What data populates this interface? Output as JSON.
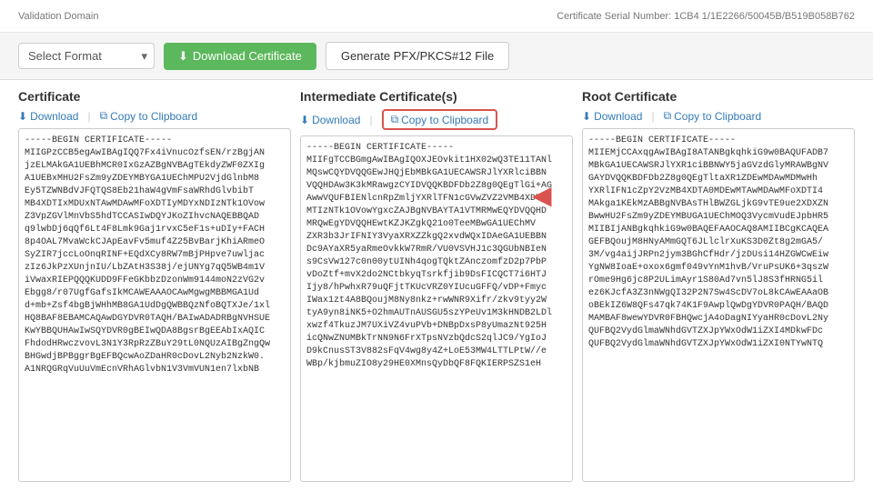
{
  "meta": {
    "left_label": "Validation Domain",
    "right_label": "Certificate Serial Number: 1CB4 1/1E2266/50045B/B519B058B762"
  },
  "toolbar": {
    "select_placeholder": "Select Format",
    "download_btn": "Download Certificate",
    "pfx_btn": "Generate PFX/PKCS#12 File",
    "download_icon": "⬇"
  },
  "columns": [
    {
      "id": "certificate",
      "title": "Certificate",
      "download_label": "Download",
      "copy_label": "Copy to Clipboard",
      "cert_text": "-----BEGIN CERTIFICATE-----\nMIIGPzCCB5egAwIBAgIQQ7Fx4iVnucOzfsEN/rzBgjAN\njzELMAkGA1UEBhMCR0IxGzAZBgNVBAgTEkdyZWF0ZXIg\nA1UEBxMHU2FsZm9yZDEYMBYGA1UEChMPU2VjdGlnbM8\nEy5TZWNBdVJFQTQS8Eb21haW4gVmFsaWRhdGlvbibT\nMB4XDTIxMDUxNTAwMDAwMFoXDTIyMDYxNDIzNTk1OVow\nZ3VpZGVlMnVbS5hdTCCASIwDQYJKoZIhvcNAQEBBQAD\nq9lwbDj6qQf6Lt4F8Lmk9Gaj1rvxC5eF1s+uDIy+FACH\n8p4OAL7MvaWckCJApEavFv5muf4Z25BvBarjKhiARmeO\nSyZIR7jccLoOnqRINF+EQdXCy8RW7mBjPHpve7uwljac\nzIz6JkPzXUnjnIU/LbZAtH3S38j/ejUNYg7qQ5WB4m1V\niVwaxRIEPQQQKUDD9FFeGKbbzDzonWm9144moN2zVG2v\nEbgg8/r07UgfGafsIkMCAWEAAAOCAwMgwgMBBMGA1Ud\nd+mb+Zsf4bgBjWHhMB8GA1UdDgQWBBQzNfoBQTXJe/1xl\nHQ8BAF8EBAMCAQAwDGYDVR0TAQH/BAIwADADRBgNVHSUE\nKwYBBQUHAwIwSQYDVR0gBEIwQDA8BgsrBgEEAbIxAQIC\nFhdodHRwczvovL3N1Y3RpRzZBuY29tL0NQUzAIBgZngQw\nBHGwdjBPBggrBgEFBQcwAoZDaHR0cDovL2Nyb2NzkW0.\nA1NRQGRqVuUuVmEcnVRhAGlvbN1V3VmVUN1en7lxbNB"
    },
    {
      "id": "intermediate",
      "title": "Intermediate Certificate(s)",
      "download_label": "Download",
      "copy_label": "Copy to Clipboard",
      "cert_text": "-----BEGIN CERTIFICATE-----\nMIIFgTCCBGmgAwIBAgIQOXJEOvkit1HX02wQ3TE11TANl\nMQswCQYDVQQGEwJHQjEbMBkGA1UECAWSRJlYXRlciBBN\nVQQHDAw3K3kMRawgzCYIDVQQKBDFDb2Z8g0QEgTlGi+AG\nAwwVQUFBIENlcnRpZmljYXRlTFN1cGVwZVZ2VMB4XDTE5\nMTIzNTk1OVowYgxcZAJBgNVBAYTA1VTMRMwEQYDVQQHD\nMRQwEgYDVQQHEwtKZJKZgkQ21o0TeeMBwGA1UEChMV\nZXR3b3JrIFNIY3VyaXRXZZkgQ2xvdWQxIDAeGA1UEBBN\nDc9AYaXR5yaRmeOvkkW7RmR/VU0VSVHJ1c3QGUbNBIeN\ns9CsVw127c0n00ytUINh4qogTQktZAnczomfzD2p7PbP\nvDoZtf+mvX2do2NCtbkyqTsrkfjib9DsFICQCT7i6HTJ\nIjy8/hPwhxR79uQFjtTKUcVRZ0YIUcuGFFQ/vDP+Fmyc\nIWax1zt4A8BQoujM8Ny8nkz+rwWNR9Xifr/zkv9tyy2W\ntyA9yn8iNK5+O2hmAUTnAUSGU5szYPeUv1M3kHNDB2LDl\nxwzf4TkuzJM7UXiVZ4vuPVb+DNBpDxsP8yUmazNt925H\nicQNwZNUMBkTrNN9N6FrXTpsNVzbQdcS2qlJC9/YgIoJ\nD9kCnusST3V882sFqV4wg8y4Z+LoE53MW4LTTLPtW//e\nWBp/kjbmuZIO8y29HE0XMnsQyDbQF8FQKIERPSZS1eH"
    },
    {
      "id": "root",
      "title": "Root Certificate",
      "download_label": "Download",
      "copy_label": "Copy to Clipboard",
      "cert_text": "-----BEGIN CERTIFICATE-----\nMIIEMjCCAxqgAwIBAgI8ATANBgkqhkiG9w0BAQUFADB7\nMBkGA1UECAWSRJlYXR1ciBBNWY5jaGVzdGlyMRAWBgNV\nGAYDVQQKBDFDb2Z8g0QEgTltaXR1ZDEwMDAwMDMwHh\nYXRlIFN1cZpY2VzMB4XDTA0MDEwMTAwMDAwMFoXDTI4\nMAkga1KEkMzABBgNVBAsTHlBWZGLjkG9vTE9ue2XDXZN\nBwwHU2FsZm9yZDEYMBUGA1UEChMOQ3VycmVudEJpbHR5\nMIIBIjANBgkqhkiG9w0BAQEFAAOCAQ8AMIIBCgKCAQEA\nGEFBQoujM8HNyAMmGQT6JLlclrXuKS3D0Zt8g2mGA5/\n3M/vg4aijJRPn2jym3BGhCfHdr/jzDUsi14HZGWCwEiw\nYgNW8IoaE+oxox6gmf049vYnM1hvB/VruPsUK6+3qszW\nrOme9Hg6jc8P2ULimAyr1S80Ad7vn5lJ8S3fHRNG5il\nez6KJcfA3Z3nNWgQI32P2N7Sw4ScDV7oL8kCAwEAAaOB\noBEkIZ6W8QFs47qk74K1F9AwplQwDgYDVR0PAQH/BAQD\nMAMBAF8wewYDVR0FBHQwcjA4oDagNIYyaHR0cDovL2Ny\nQUFBQ2VydGlmaWNhdGVTZXJpYWxOdW1iZXI4MDkwFDc\nQUFBQ2VydGlmaWNhdGVTZXJpYWxOdW1iZXI0NTYwNTQ"
    }
  ]
}
